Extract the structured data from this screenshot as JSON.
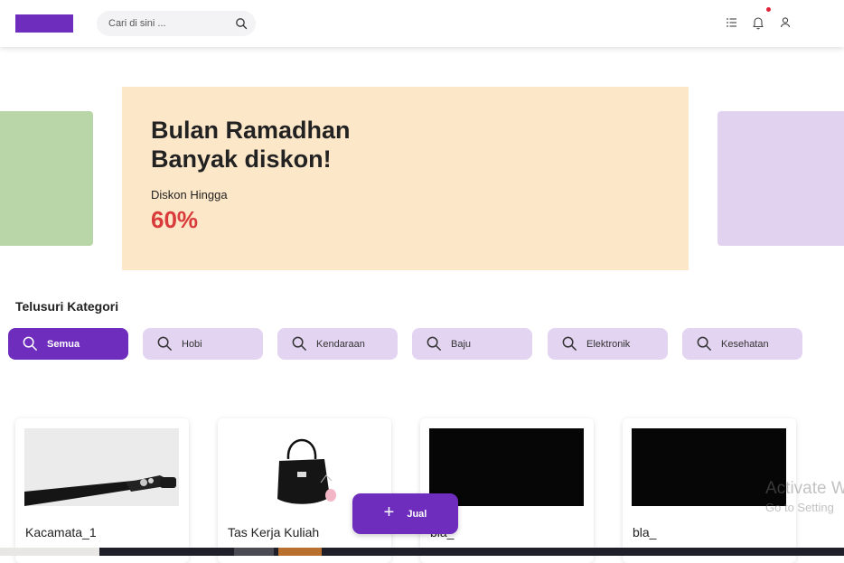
{
  "header": {
    "search": {
      "placeholder": "Cari di sini ...",
      "icon": "search-icon"
    },
    "icons": [
      "list-icon",
      "bell-icon",
      "user-icon"
    ],
    "notification_dot": true
  },
  "banner": {
    "title_line1": "Bulan Ramadhan",
    "title_line2": "Banyak diskon!",
    "subtitle": "Diskon Hingga",
    "discount": "60%"
  },
  "categories": {
    "title": "Telusuri Kategori",
    "items": [
      {
        "label": "Semua",
        "active": true
      },
      {
        "label": "Hobi",
        "active": false
      },
      {
        "label": "Kendaraan",
        "active": false
      },
      {
        "label": "Baju",
        "active": false
      },
      {
        "label": "Elektronik",
        "active": false
      },
      {
        "label": "Kesehatan",
        "active": false
      }
    ]
  },
  "products": [
    {
      "name": "Kacamata_1"
    },
    {
      "name": "Tas Kerja Kuliah"
    },
    {
      "name": "bla_"
    },
    {
      "name": "bla_"
    }
  ],
  "fab": {
    "label": "Jual",
    "icon": "plus-icon"
  },
  "watermark": {
    "title": "Activate W",
    "subtitle": "Go to Setting"
  },
  "colors": {
    "brand": "#6f2dbd",
    "category_bg": "#e3d4f1",
    "banner_bg": "#fde7c9",
    "discount": "#d93a3a",
    "slide_left": "#b8d6a7",
    "slide_right": "#e1d3f0"
  }
}
